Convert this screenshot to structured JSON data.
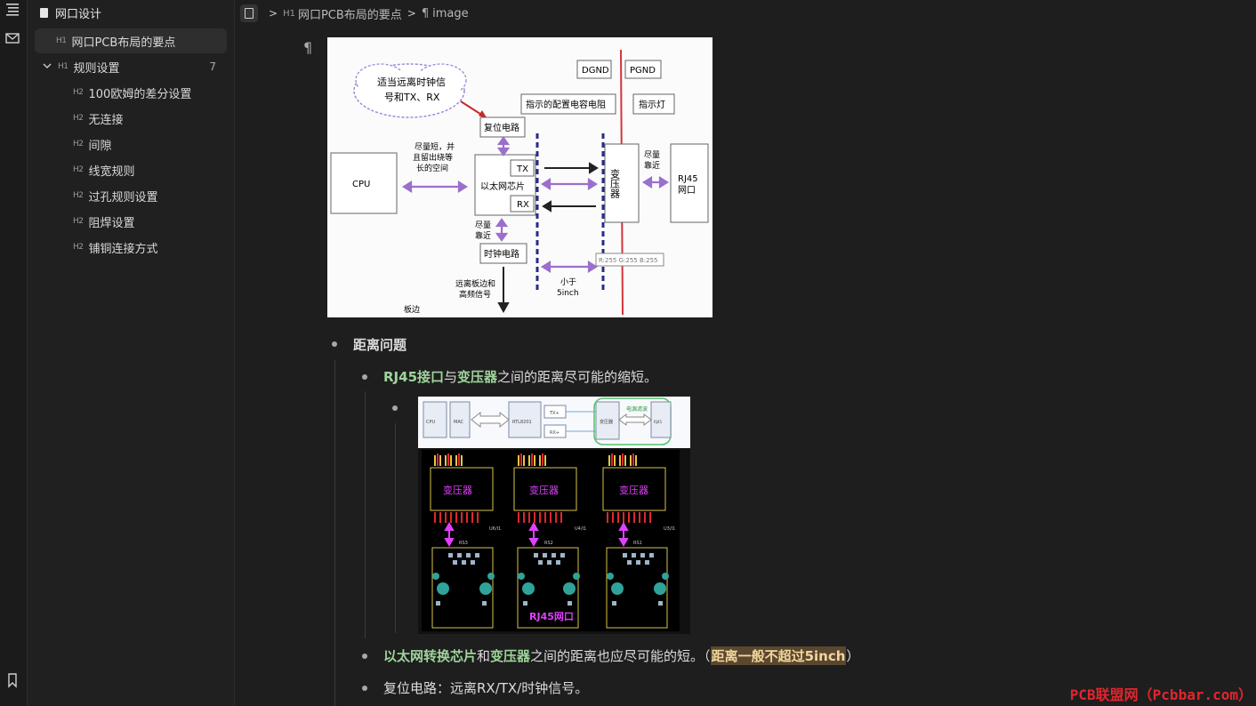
{
  "outline": {
    "doc_title": "网口设计",
    "items": [
      {
        "level": "H1",
        "label": "网口PCB布局的要点"
      },
      {
        "level": "H1",
        "label": "规则设置",
        "count": "7"
      },
      {
        "level": "H2",
        "label": "100欧姆的差分设置"
      },
      {
        "level": "H2",
        "label": "无连接"
      },
      {
        "level": "H2",
        "label": "间隙"
      },
      {
        "level": "H2",
        "label": "线宽规则"
      },
      {
        "level": "H2",
        "label": "过孔规则设置"
      },
      {
        "level": "H2",
        "label": "阻焊设置"
      },
      {
        "level": "H2",
        "label": "铺铜连接方式"
      }
    ]
  },
  "breadcrumb": {
    "heading_level": "H1",
    "heading": "网口PCB布局的要点",
    "pilcrow": "¶",
    "leaf": "image"
  },
  "diagram1": {
    "cloud": [
      "适当远离时钟信",
      "号和TX、RX"
    ],
    "dgnd": "DGND",
    "pgnd": "PGND",
    "cap_note": "指示的配置电容电阻",
    "led": "指示灯",
    "reset": "复位电路",
    "cpu": "CPU",
    "short_note": [
      "尽量短，并",
      "且留出绕等",
      "长的空间"
    ],
    "phy": "以太网芯片",
    "tx": "TX",
    "rx": "RX",
    "transformer": "变压器",
    "near1": [
      "尽量",
      "靠近"
    ],
    "rj45": [
      "RJ45",
      "网口"
    ],
    "near2": [
      "尽量",
      "靠近"
    ],
    "clock": "时钟电路",
    "rgb": "R:255 G:255 B:255",
    "away_note": [
      "远离板边和",
      "高频信号"
    ],
    "lt5": [
      "小于",
      "5inch"
    ],
    "edge": "板边"
  },
  "diagram2": {
    "top_labels": [
      "CPU",
      "MAC",
      "RTL8201",
      "TX+",
      "RX+",
      "变压器",
      "电源滤波",
      "RJ45"
    ],
    "transformer": "变压器",
    "rj45": "RJ45网口",
    "silk": [
      "U6/I1",
      "U4/I1",
      "U3/I1",
      "RS3",
      "RS2",
      "RS1"
    ]
  },
  "content": {
    "pilcrow": "¶",
    "b1": "距离问题",
    "b2_a": "RJ45接口",
    "b2_b": "与",
    "b2_c": "变压器",
    "b2_d": "之间的距离尽可能的缩短。",
    "b3_a": "以太网转换芯片",
    "b3_b": "和",
    "b3_c": "变压器",
    "b3_d": "之间的距离也应尽可能的短。（",
    "b3_e": "距离一般不超过5inch",
    "b3_f": "）",
    "b4": "复位电路：远离RX/TX/时钟信号。"
  },
  "watermark": "PCB联盟网（Pcbbar.com）",
  "colors": {
    "accent_green": "#9fd49b",
    "highlight_bg": "#5b4630",
    "watermark": "#e0262e"
  }
}
